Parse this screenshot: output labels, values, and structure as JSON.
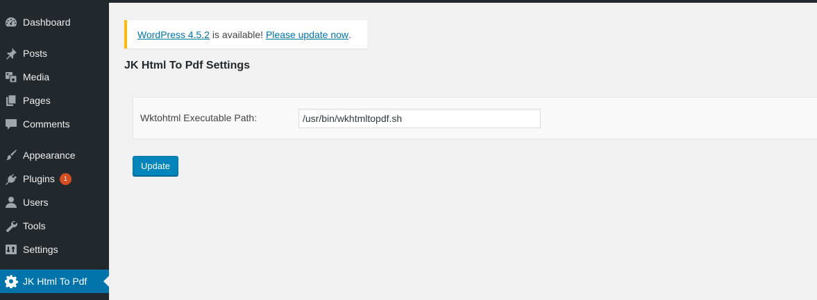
{
  "sidebar": {
    "items": [
      {
        "label": "Dashboard",
        "icon": "dashboard-icon"
      },
      {
        "label": "Posts",
        "icon": "pushpin-icon"
      },
      {
        "label": "Media",
        "icon": "media-icon"
      },
      {
        "label": "Pages",
        "icon": "pages-icon"
      },
      {
        "label": "Comments",
        "icon": "comment-icon"
      },
      {
        "label": "Appearance",
        "icon": "paintbrush-icon"
      },
      {
        "label": "Plugins",
        "icon": "plugin-icon",
        "badge": "1"
      },
      {
        "label": "Users",
        "icon": "user-icon"
      },
      {
        "label": "Tools",
        "icon": "wrench-icon"
      },
      {
        "label": "Settings",
        "icon": "settings-icon"
      },
      {
        "label": "JK Html To Pdf",
        "icon": "gear-icon",
        "active": true
      }
    ]
  },
  "notice": {
    "version_link": "WordPress 4.5.2",
    "middle_text": " is available! ",
    "update_link": "Please update now",
    "end_text": "."
  },
  "page": {
    "title": "JK Html To Pdf Settings"
  },
  "form": {
    "label": "Wktohtml Executable Path:",
    "path_value": "/usr/bin/wkhtmltopdf.sh",
    "submit_label": "Update"
  },
  "colors": {
    "sidebar_bg": "#23282d",
    "active_bg": "#0073aa",
    "notice_border": "#ffb900",
    "badge_bg": "#d54e21",
    "button_bg": "#0085ba",
    "link": "#0073aa"
  }
}
